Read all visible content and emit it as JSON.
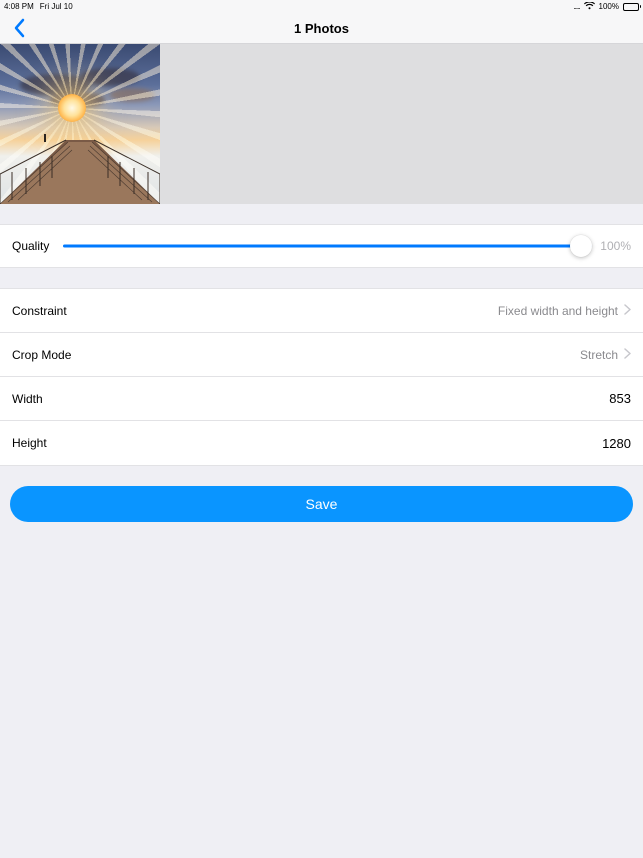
{
  "status": {
    "time": "4:08 PM",
    "date": "Fri Jul 10",
    "signal_dots": ".....",
    "wifi": true,
    "battery_percent": "100%"
  },
  "nav": {
    "title": "1 Photos"
  },
  "quality": {
    "label": "Quality",
    "value_text": "100%",
    "value": 100
  },
  "settings": {
    "constraint": {
      "label": "Constraint",
      "value": "Fixed width and height"
    },
    "crop_mode": {
      "label": "Crop Mode",
      "value": "Stretch"
    },
    "width": {
      "label": "Width",
      "value": "853"
    },
    "height": {
      "label": "Height",
      "value": "1280"
    }
  },
  "actions": {
    "save": "Save"
  }
}
